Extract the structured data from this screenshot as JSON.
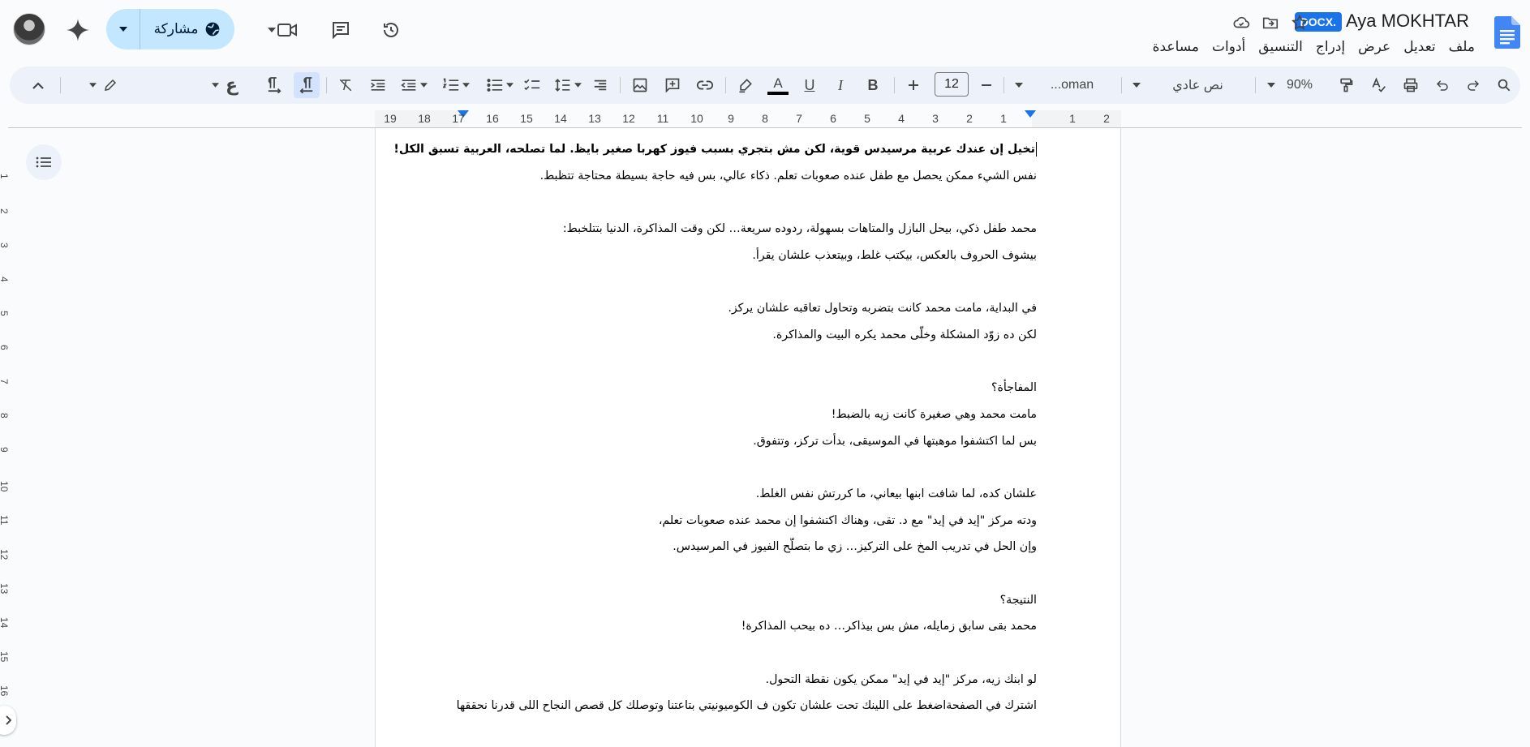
{
  "header": {
    "title": "Aya MOKHTAR",
    "format_badge": "DOCX.",
    "share_label": "مشاركة",
    "menu": [
      "ملف",
      "تعديل",
      "عرض",
      "إدراج",
      "التنسيق",
      "أدوات",
      "مساعدة"
    ]
  },
  "toolbar": {
    "zoom": "90%",
    "style": "نص عادي",
    "font": "...oman",
    "font_size": "12",
    "language_glyph": "ع"
  },
  "ruler": {
    "numbers": [
      "2",
      "1",
      "",
      "1",
      "2",
      "3",
      "4",
      "5",
      "6",
      "7",
      "8",
      "9",
      "10",
      "11",
      "12",
      "13",
      "14",
      "15",
      "16",
      "17",
      "18",
      "19"
    ]
  },
  "vertical_ruler": [
    "1",
    "2",
    "3",
    "4",
    "5",
    "6",
    "7",
    "8",
    "9",
    "10",
    "11",
    "12",
    "13",
    "14",
    "15",
    "16"
  ],
  "document": {
    "lines": [
      {
        "text": "تخيل إن عندك عربية مرسيدس قوية، لكن مش بتجري بسبب فيوز كهربا صغير بايظ. لما تصلحه، العربية تسبق الكل!",
        "bold": true
      },
      {
        "text": "نفس الشيء ممكن يحصل مع طفل عنده صعوبات تعلم. ذكاء عالي، بس فيه حاجة بسيطة محتاجة تتظبط."
      },
      {
        "text": ""
      },
      {
        "text": "محمد طفل ذكي، بيحل البازل والمتاهات بسهولة، ردوده سريعة… لكن وقت المذاكرة، الدنيا بتتلخبط:"
      },
      {
        "text": "بيشوف الحروف بالعكس، بيكتب غلط، وبيتعذب علشان يقرأ."
      },
      {
        "text": ""
      },
      {
        "text": "في البداية، مامت محمد كانت بتضربه وتحاول تعاقبه علشان يركز."
      },
      {
        "text": "لكن ده زوّد المشكلة وخلّى محمد يكره البيت والمذاكرة."
      },
      {
        "text": ""
      },
      {
        "text": "المفاجأة؟"
      },
      {
        "text": "مامت محمد وهي صغيرة كانت زيه بالضبط!"
      },
      {
        "text": "بس لما اكتشفوا موهبتها في الموسيقى، بدأت تركز، وتتفوق."
      },
      {
        "text": ""
      },
      {
        "text": "علشان كده، لما شافت ابنها بيعاني، ما كررتش نفس الغلط."
      },
      {
        "text": "ودته مركز \"إيد في إيد\" مع د. تقى، وهناك اكتشفوا إن محمد عنده صعوبات تعلم،"
      },
      {
        "text": "وإن الحل في تدريب المخ على التركيز… زي ما بتصلّح الفيوز في المرسيدس."
      },
      {
        "text": ""
      },
      {
        "text": "النتيجة؟"
      },
      {
        "text": "محمد بقى سابق زمايله، مش بس بيذاكر… ده بيحب المذاكرة!"
      },
      {
        "text": ""
      },
      {
        "text": "لو ابنك زيه، مركز \"إيد في إيد\" ممكن يكون نقطة التحول."
      },
      {
        "text": "اشترك في الصفحةاضغط على اللينك تحت علشان تكون ف الكوميونيتي بتاعتنا وتوصلك كل قصص النجاح اللى قدرنا نحققها"
      }
    ]
  }
}
